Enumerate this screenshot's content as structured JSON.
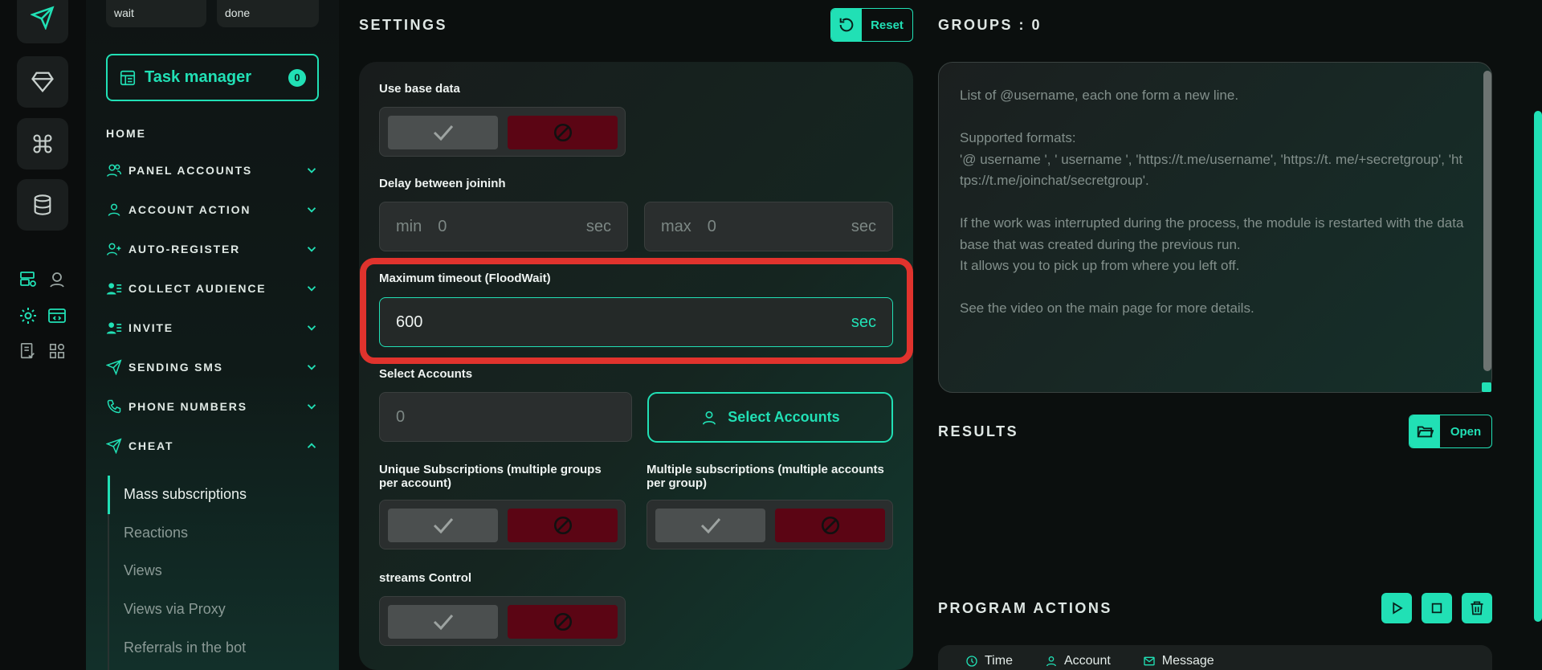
{
  "topPills": {
    "wait": "wait",
    "done": "done"
  },
  "sidebar": {
    "taskManager": {
      "label": "Task manager",
      "count": "0"
    },
    "home": "HOME",
    "items": [
      {
        "label": "PANEL ACCOUNTS",
        "icon": "users-icon"
      },
      {
        "label": "ACCOUNT ACTION",
        "icon": "user-icon"
      },
      {
        "label": "AUTO-REGISTER",
        "icon": "user-plus-icon"
      },
      {
        "label": "COLLECT AUDIENCE",
        "icon": "user-list-icon"
      },
      {
        "label": "INVITE",
        "icon": "user-list-icon"
      },
      {
        "label": "SENDING SMS",
        "icon": "send-icon"
      },
      {
        "label": "PHONE NUMBERS",
        "icon": "phone-icon"
      },
      {
        "label": "CHEAT",
        "icon": "send-icon"
      }
    ],
    "cheatSubitems": [
      "Mass subscriptions",
      "Reactions",
      "Views",
      "Views via Proxy",
      "Referrals in the bot"
    ]
  },
  "settings": {
    "title": "SETTINGS",
    "resetLabel": "Reset",
    "useBaseData": "Use base data",
    "delayLabel": "Delay between joininh",
    "minPrefix": "min",
    "minValue": "0",
    "maxPrefix": "max",
    "maxValue": "0",
    "secUnit": "sec",
    "maxTimeoutLabel": "Maximum timeout (FloodWait)",
    "maxTimeoutValue": "600",
    "selectAccountsLabel": "Select Accounts",
    "selectedCount": "0",
    "selectAccountsButton": "Select Accounts",
    "uniqueSubsLabel": "Unique Subscriptions (multiple groups per account)",
    "multipleSubsLabel": "Multiple subscriptions (multiple accounts per group)",
    "streamsLabel": "streams Control"
  },
  "groups": {
    "title": "GROUPS : 0",
    "placeholder": "List of @username, each one form a new line.\n\nSupported formats:\n'@ username ', ' username ', 'https://t.me/username', 'https://t. me/+secretgroup', 'https://t.me/joinchat/secretgroup'.\n\nIf the work was interrupted during the process, the module is restarted with the database that was created during the previous run.\nIt allows you to pick up from where you left off.\n\nSee the video on the main page for more details."
  },
  "results": {
    "title": "RESULTS",
    "openLabel": "Open"
  },
  "programActions": {
    "title": "PROGRAM ACTIONS",
    "columns": [
      "Time",
      "Account",
      "Message"
    ]
  },
  "colors": {
    "accent": "#21e0b5",
    "danger": "#5b0514",
    "highlight": "#e0332d"
  }
}
